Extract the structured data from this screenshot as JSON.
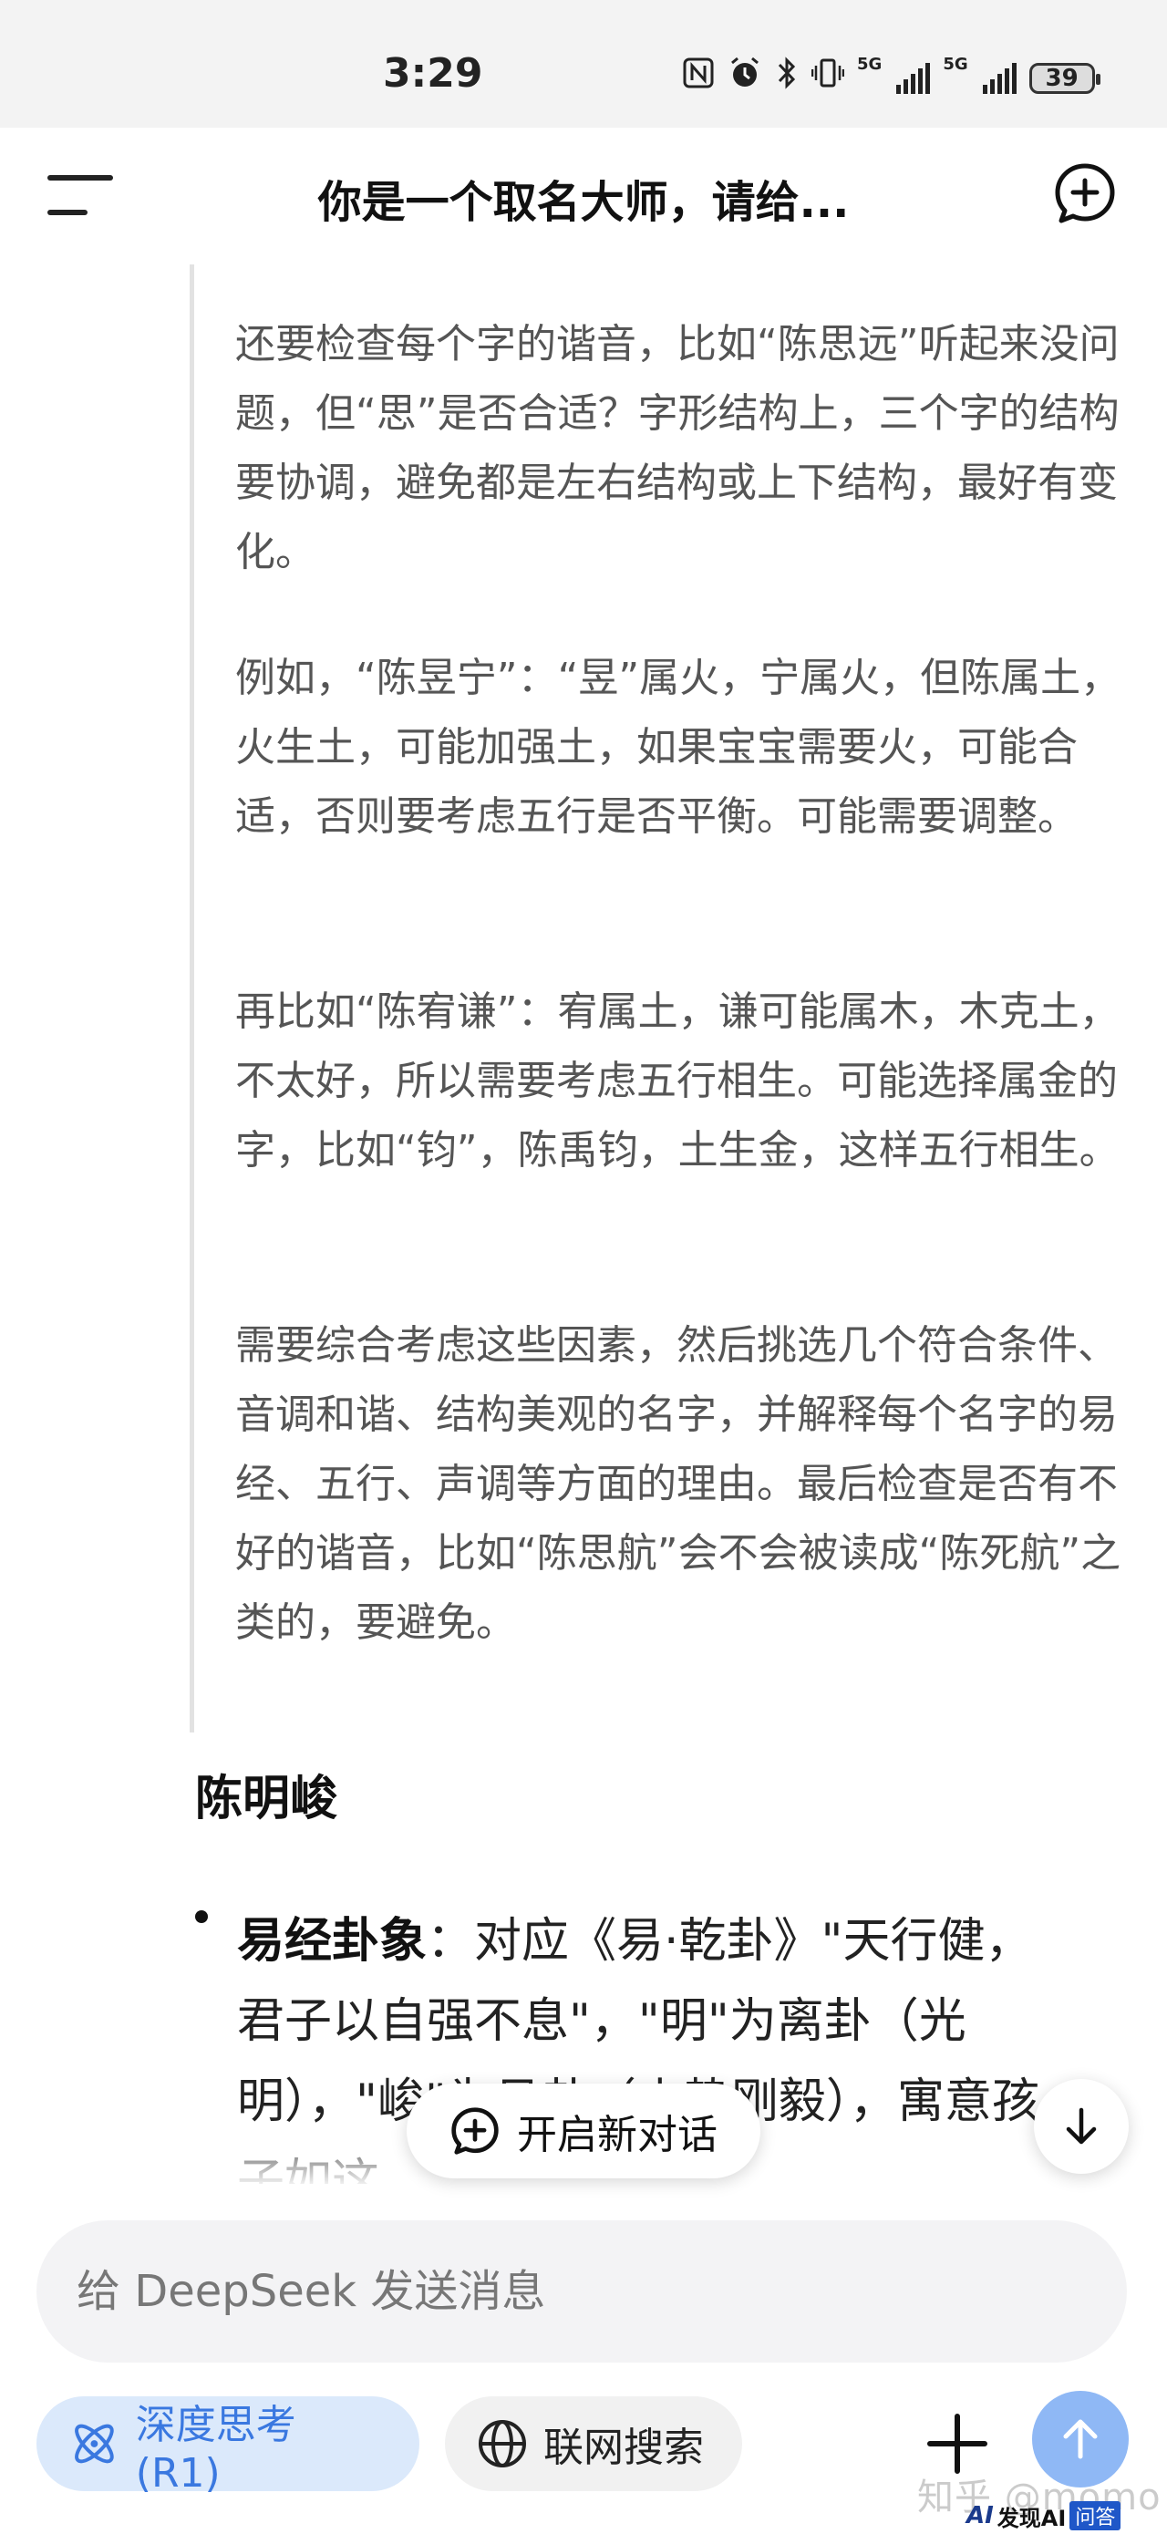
{
  "status_bar": {
    "time": "3:29",
    "icons": [
      "nfc-icon",
      "alarm-icon",
      "bluetooth-icon",
      "vibrate-icon",
      "signal-5g-icon",
      "signal-5g-icon"
    ],
    "network_1": "5G",
    "network_2": "5G",
    "battery": "39"
  },
  "header": {
    "title": "你是一个取名大师，请给..."
  },
  "thinking": {
    "paragraphs": [
      "还要检查每个字的谐音，比如“陈思远”听起来没问题，但“思”是否合适？字形结构上，三个字的结构要协调，避免都是左右结构或上下结构，最好有变化。",
      "例如，“陈昱宁”：“昱”属火，宁属火，但陈属土，火生土，可能加强土，如果宝宝需要火，可能合适，否则要考虑五行是否平衡。可能需要调整。",
      "再比如“陈宥谦”：宥属土，谦可能属木，木克土，不太好，所以需要考虑五行相生。可能选择属金的字，比如“钧”，陈禹钧，土生金，这样五行相生。",
      "需要综合考虑这些因素，然后挑选几个符合条件、音调和谐、结构美观的名字，并解释每个名字的易经、五行、声调等方面的理由。最后检查是否有不好的谐音，比如“陈思航”会不会被读成“陈死航”之类的，要避免。"
    ]
  },
  "answer": {
    "name_heading": "陈明峻",
    "bullet_label": "易经卦象",
    "bullet_text": "：对应《易·乾卦》\"天行健，君子以自强不息\"，\"明\"为离卦（光明），\"峻\"为艮卦（山势刚毅），寓意孩子如这"
  },
  "floating": {
    "new_conversation_label": "开启新对话"
  },
  "composer": {
    "placeholder": "给 DeepSeek 发送消息",
    "deep_think_label": "深度思考 (R1)",
    "web_search_label": "联网搜索"
  },
  "watermark": {
    "text": "知乎 @momo",
    "logo_ai": "AI",
    "logo_text": "发现AI",
    "logo_box": "问答"
  },
  "colors": {
    "accent": "#3a78e0",
    "deep_pill_bg": "#dbe9fb",
    "send_button": "#8fb8f5",
    "thinking_text": "#555555",
    "status_bar_bg": "#f3f3f3"
  }
}
